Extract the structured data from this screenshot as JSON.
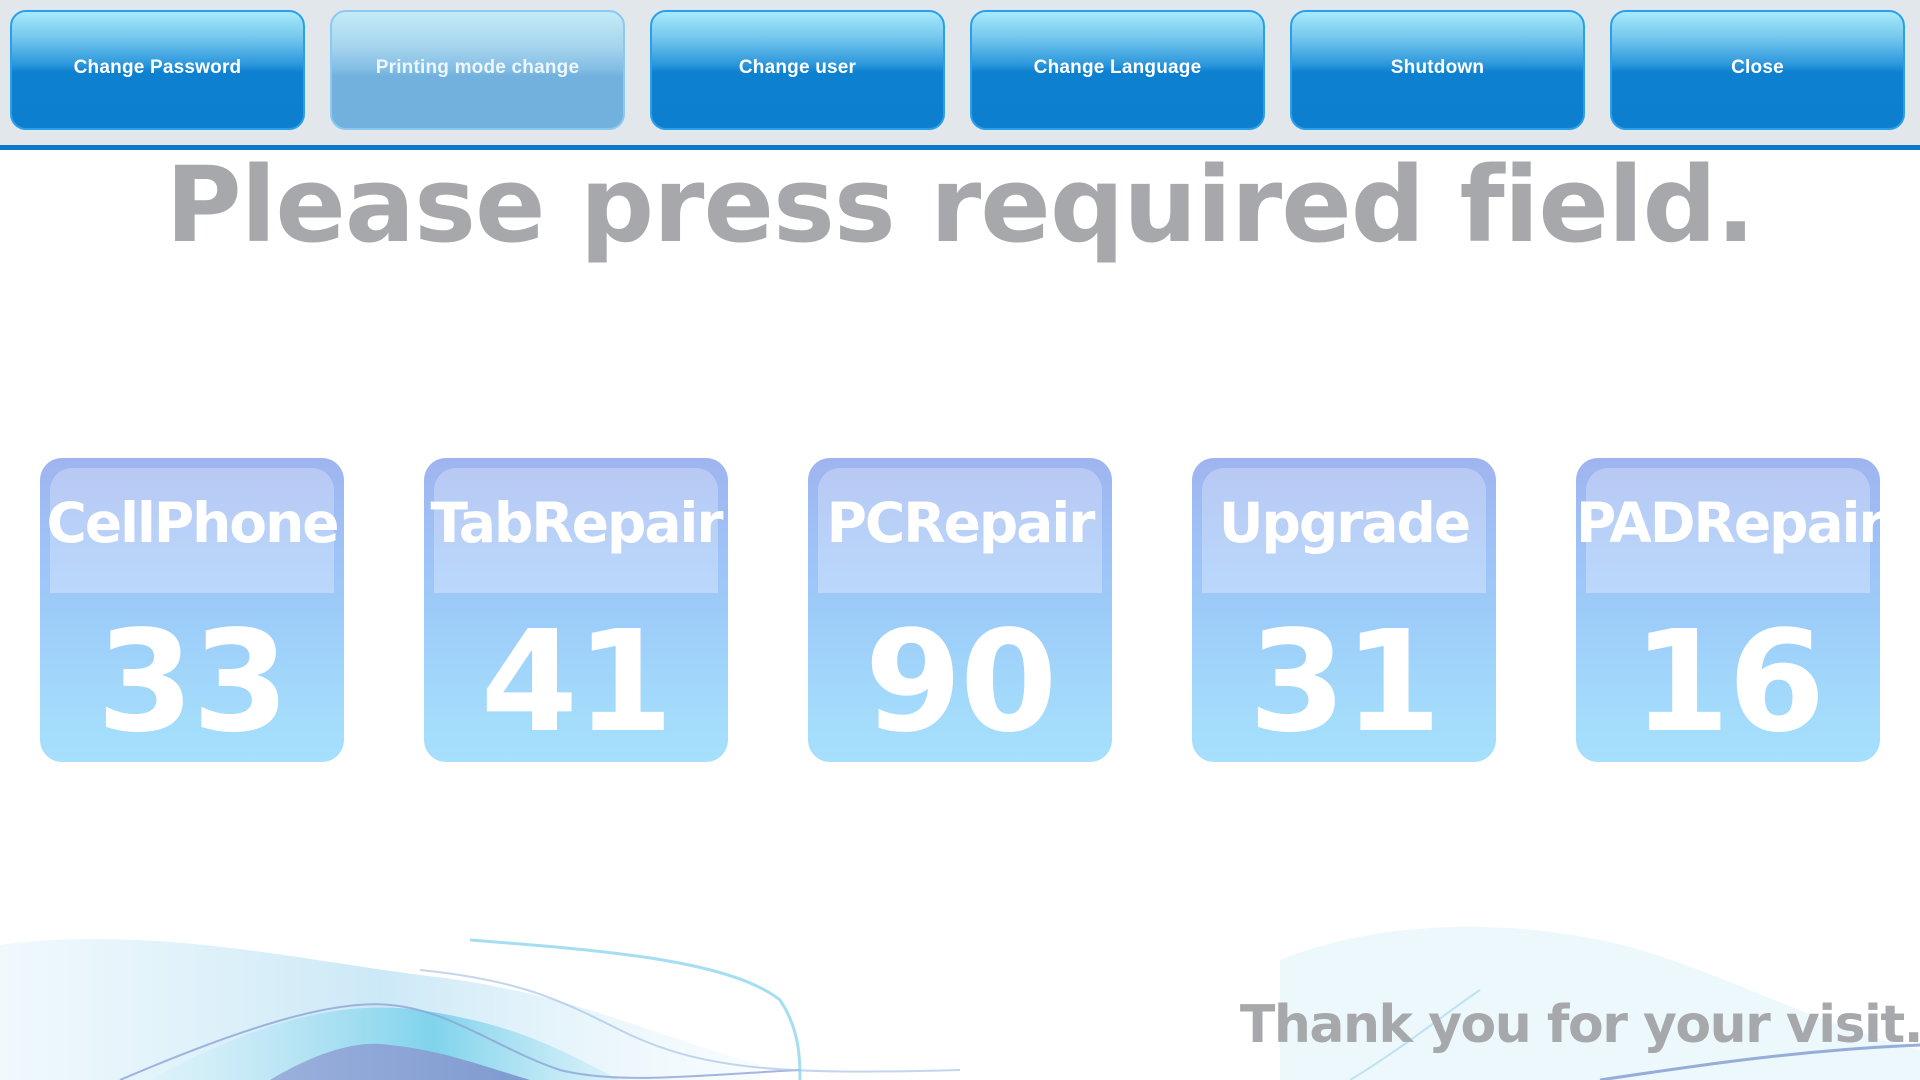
{
  "toolbar": {
    "buttons": [
      {
        "label": "Change Password",
        "enabled": true
      },
      {
        "label": "Printing mode change",
        "enabled": false
      },
      {
        "label": "Change user",
        "enabled": true
      },
      {
        "label": "Change Language",
        "enabled": true
      },
      {
        "label": "Shutdown",
        "enabled": true
      },
      {
        "label": "Close",
        "enabled": true
      }
    ]
  },
  "main": {
    "title": "Please press required field.",
    "cards": [
      {
        "label": "CellPhone",
        "count": "33"
      },
      {
        "label": "TabRepair",
        "count": "41"
      },
      {
        "label": "PCRepair",
        "count": "90"
      },
      {
        "label": "Upgrade",
        "count": "31"
      },
      {
        "label": "PADRepair",
        "count": "16"
      }
    ]
  },
  "footer": {
    "message": "Thank you for your visit."
  },
  "colors": {
    "accent": "#0b78c9",
    "button_blue": "#0c7fcf",
    "text_gray": "#a7a8ab",
    "card_blue": "#9ccbf9"
  }
}
